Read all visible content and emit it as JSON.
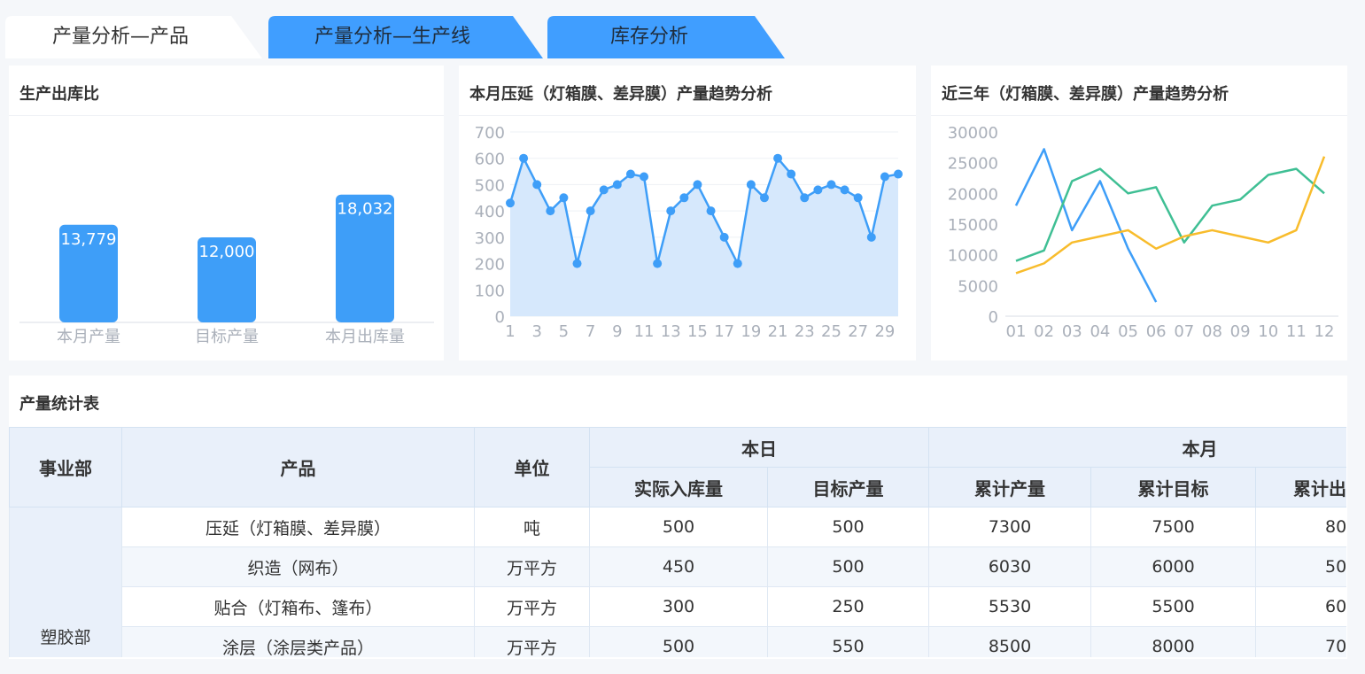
{
  "tabs": [
    {
      "label": "产量分析—产品",
      "active": true
    },
    {
      "label": "产量分析—生产线",
      "active": false
    },
    {
      "label": "库存分析",
      "active": false
    }
  ],
  "colors": {
    "primary": "#3e9ef8",
    "tab_active": "#ffffff",
    "tab_inactive": "#409eff",
    "green": "#3fbf94",
    "yellow": "#f8bc2c"
  },
  "ratio_panel": {
    "title": "生产出库比",
    "chart_data": {
      "type": "bar",
      "categories": [
        "本月产量",
        "目标产量",
        "本月出库量"
      ],
      "values": [
        13779,
        12000,
        18032
      ],
      "value_labels": [
        "13,779",
        "12,000",
        "18,032"
      ],
      "ylim": [
        0,
        20000
      ]
    }
  },
  "month_panel": {
    "title": "本月压延（灯箱膜、差异膜）产量趋势分析",
    "chart_data": {
      "type": "area",
      "x": [
        1,
        2,
        3,
        4,
        5,
        6,
        7,
        8,
        9,
        10,
        11,
        12,
        13,
        14,
        15,
        16,
        17,
        18,
        19,
        20,
        21,
        22,
        23,
        24,
        25,
        26,
        27,
        28,
        29,
        30
      ],
      "x_ticks": [
        "1",
        "3",
        "5",
        "7",
        "9",
        "11",
        "13",
        "15",
        "17",
        "19",
        "21",
        "23",
        "25",
        "27",
        "29"
      ],
      "values": [
        430,
        600,
        500,
        400,
        450,
        200,
        400,
        480,
        500,
        540,
        530,
        200,
        400,
        450,
        500,
        400,
        300,
        200,
        500,
        450,
        600,
        540,
        450,
        480,
        500,
        480,
        450,
        300,
        530,
        540
      ],
      "y_ticks": [
        "0",
        "100",
        "200",
        "300",
        "400",
        "500",
        "600",
        "700"
      ],
      "ylim": [
        0,
        700
      ]
    }
  },
  "year_panel": {
    "title": "近三年（灯箱膜、差异膜）产量趋势分析",
    "chart_data": {
      "type": "line",
      "categories": [
        "01",
        "02",
        "03",
        "04",
        "05",
        "06",
        "07",
        "08",
        "09",
        "10",
        "11",
        "12"
      ],
      "y_ticks": [
        "0",
        "5000",
        "10000",
        "15000",
        "20000",
        "25000",
        "30000"
      ],
      "ylim": [
        0,
        30000
      ],
      "series": [
        {
          "color": "#3e9ef8",
          "values": [
            18000,
            27200,
            14000,
            22000,
            11000,
            2300,
            null,
            null,
            null,
            null,
            null,
            null
          ]
        },
        {
          "color": "#3fbf94",
          "values": [
            9000,
            10700,
            22000,
            24000,
            20000,
            21000,
            12000,
            18000,
            19000,
            23000,
            24000,
            20000
          ]
        },
        {
          "color": "#f8bc2c",
          "values": [
            7000,
            8600,
            12000,
            13000,
            14000,
            11000,
            13000,
            14000,
            13000,
            12000,
            14000,
            26000
          ]
        }
      ]
    }
  },
  "table_panel": {
    "title": "产量统计表",
    "headers": {
      "dept": "事业部",
      "product": "产品",
      "unit": "单位",
      "today": "本日",
      "month": "本月",
      "today_actual": "实际入库量",
      "today_target": "目标产量",
      "month_cum_output": "累计产量",
      "month_cum_target": "累计目标",
      "month_cum_out": "累计出"
    },
    "dept": "塑胶部",
    "rows": [
      {
        "product": "压延（灯箱膜、差异膜）",
        "unit": "吨",
        "actual": "500",
        "target": "500",
        "cum_output": "7300",
        "cum_target": "7500",
        "cum_out": "80"
      },
      {
        "product": "织造（网布）",
        "unit": "万平方",
        "actual": "450",
        "target": "500",
        "cum_output": "6030",
        "cum_target": "6000",
        "cum_out": "50"
      },
      {
        "product": "贴合（灯箱布、篷布）",
        "unit": "万平方",
        "actual": "300",
        "target": "250",
        "cum_output": "5530",
        "cum_target": "5500",
        "cum_out": "60"
      },
      {
        "product": "涂层（涂层类产品）",
        "unit": "万平方",
        "actual": "500",
        "target": "550",
        "cum_output": "8500",
        "cum_target": "8000",
        "cum_out": "70"
      }
    ]
  }
}
